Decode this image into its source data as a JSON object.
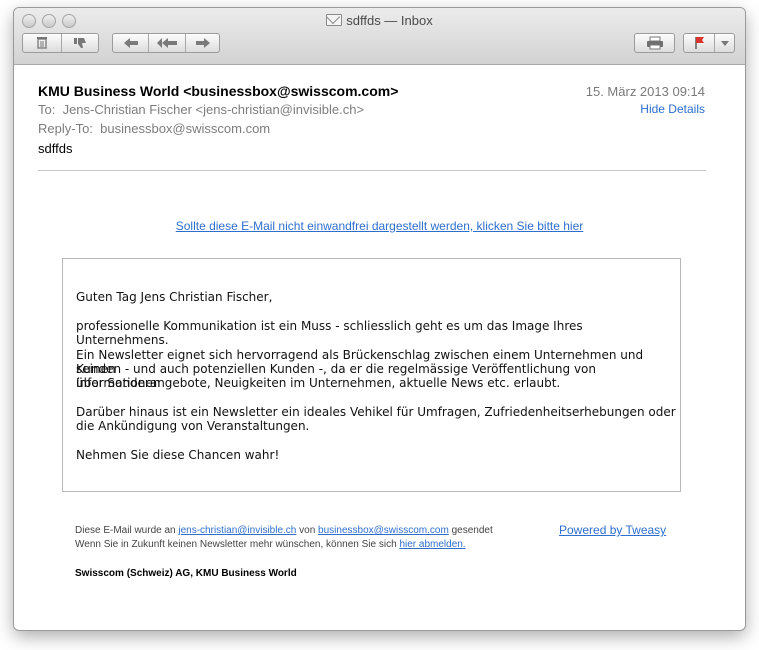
{
  "window": {
    "title": "sdffds — Inbox"
  },
  "toolbar": {
    "delete_icon": "trash-icon",
    "junk_icon": "thumbs-down-icon",
    "reply_icon": "reply-arrow-icon",
    "reply_all_icon": "reply-all-arrow-icon",
    "forward_icon": "forward-arrow-icon",
    "print_icon": "printer-icon",
    "flag_icon": "flag-icon",
    "flag_color": "#d9342b"
  },
  "header": {
    "from": "KMU Business World <businessbox@swisscom.com>",
    "date": "15. März 2013 09:14",
    "hide_details": "Hide Details",
    "to_label": "To:",
    "to_value": "Jens-Christian Fischer <jens-christian@invisible.ch>",
    "reply_to_label": "Reply-To:",
    "reply_to_value": "businessbox@swisscom.com",
    "subject": "sdffds"
  },
  "body": {
    "view_link": "Sollte diese E-Mail nicht einwandfrei dargestellt werden, klicken Sie bitte hier",
    "greeting": "Guten Tag Jens Christian Fischer,",
    "p1": "professionelle Kommunikation ist ein Muss - schliesslich geht es um das Image Ihres Unternehmens.",
    "p2_line1": "Ein Newsletter eignet sich hervorragend als Brückenschlag zwischen einem Unternehmen und seinen",
    "p2_line2": "Kunden - und auch potenziellen Kunden -, da er die regelmässige Veröffentlichung von Informationen",
    "p2_line3": "über Sonderangebote, Neuigkeiten im Unternehmen, aktuelle News etc. erlaubt.",
    "p3_line1": "Darüber hinaus ist ein Newsletter ein ideales Vehikel für Umfragen, Zufriedenheitserhebungen oder",
    "p3_line2": "die Ankündigung von Veranstaltungen.",
    "p4": "Nehmen Sie diese Chancen wahr!"
  },
  "footer": {
    "line1_a": "Diese E-Mail wurde an ",
    "line1_link1": "jens-christian@invisible.ch",
    "line1_b": " von ",
    "line1_link2": "businessbox@swisscom.com",
    "line1_c": " gesendet",
    "line2_a": "Wenn Sie in Zukunft keinen Newsletter mehr wünschen, können Sie sich ",
    "line2_link": "hier abmelden.",
    "powered": "Powered by Tweasy",
    "company": "Swisscom (Schweiz) AG, KMU Business World"
  }
}
